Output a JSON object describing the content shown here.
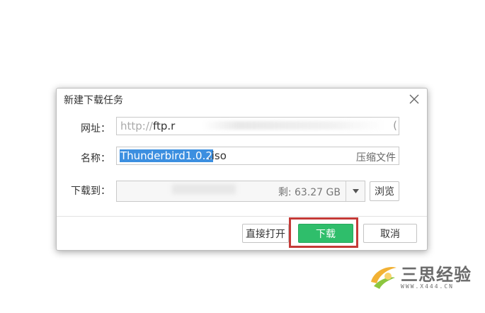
{
  "dialog": {
    "title": "新建下载任务",
    "url_label": "网址：",
    "url_prefix": "http://",
    "url_value": "ftp.r",
    "url_end": "(",
    "name_label": "名称：",
    "name_selected": "Thunderbird1.0.2",
    "name_ext": ".iso",
    "compress_label": "压缩文件",
    "path_label": "下载到：",
    "free_space": "剩: 63.27 GB",
    "browse_label": "浏览",
    "open_direct_label": "直接打开",
    "download_label": "下载",
    "cancel_label": "取消"
  },
  "watermark": {
    "text": "三思经验",
    "url": "WWW.X444.CN"
  },
  "colors": {
    "primary": "#2fbe6b",
    "selection": "#3c8fe0",
    "highlight_border": "#c43a37"
  }
}
